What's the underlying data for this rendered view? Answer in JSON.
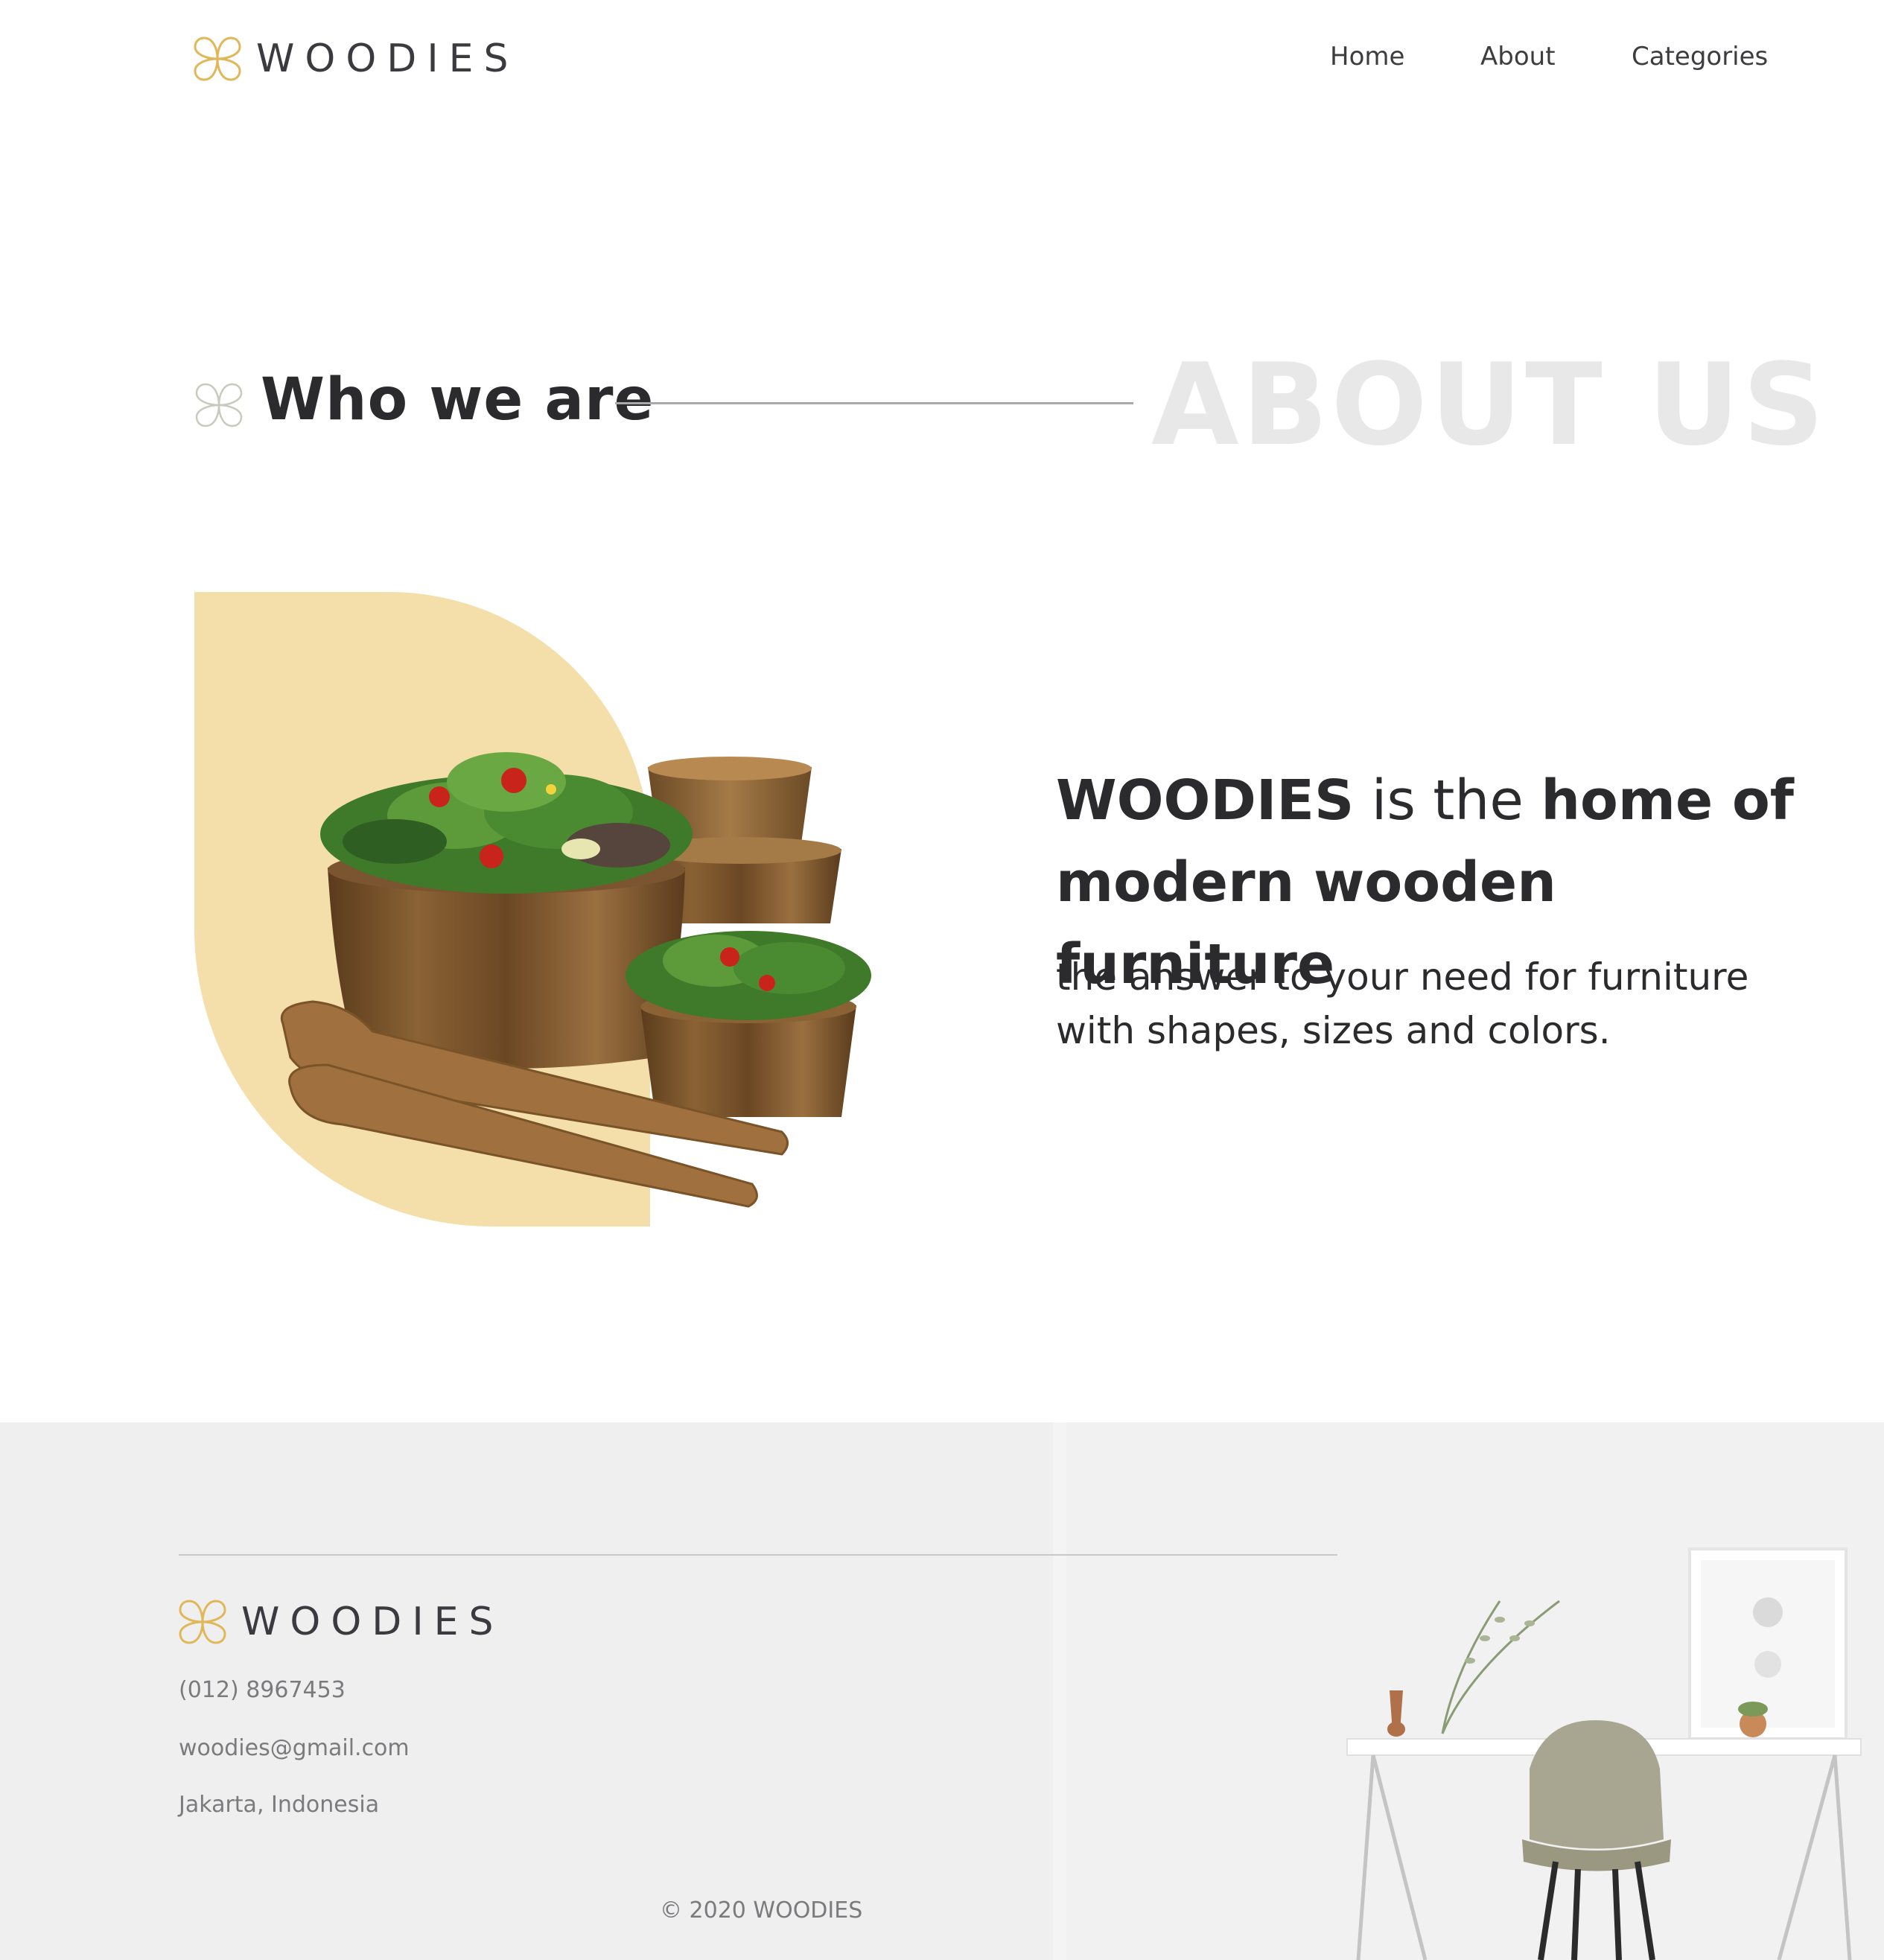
{
  "header": {
    "brand": "WOODIES",
    "logo_icon": "flower-icon",
    "nav": [
      {
        "label": "Home"
      },
      {
        "label": "About"
      },
      {
        "label": "Categories"
      }
    ]
  },
  "about": {
    "title": "Who we are",
    "ghost_title": "ABOUT US",
    "headline": {
      "brand": "WOODIES",
      "connector": " is the ",
      "emphasis": "home of modern wooden furniture"
    },
    "subline": "the answer to your need for furniture with shapes, sizes and colors.",
    "image_subject": "wooden salad bowls with serving utensils"
  },
  "footer": {
    "brand": "WOODIES",
    "phone": "(012) 8967453",
    "email": "woodies@gmail.com",
    "location": "Jakarta, Indonesia",
    "copyright": "© 2020 WOODIES",
    "image_subject": "white desk with grey chair and plants"
  },
  "colors": {
    "accent_gold": "#e0b85a",
    "shape_yellow": "#f4dfaa",
    "text_dark": "#2b2b2e",
    "ghost_text": "#e8e8e8",
    "footer_bg": "#efeff0"
  }
}
